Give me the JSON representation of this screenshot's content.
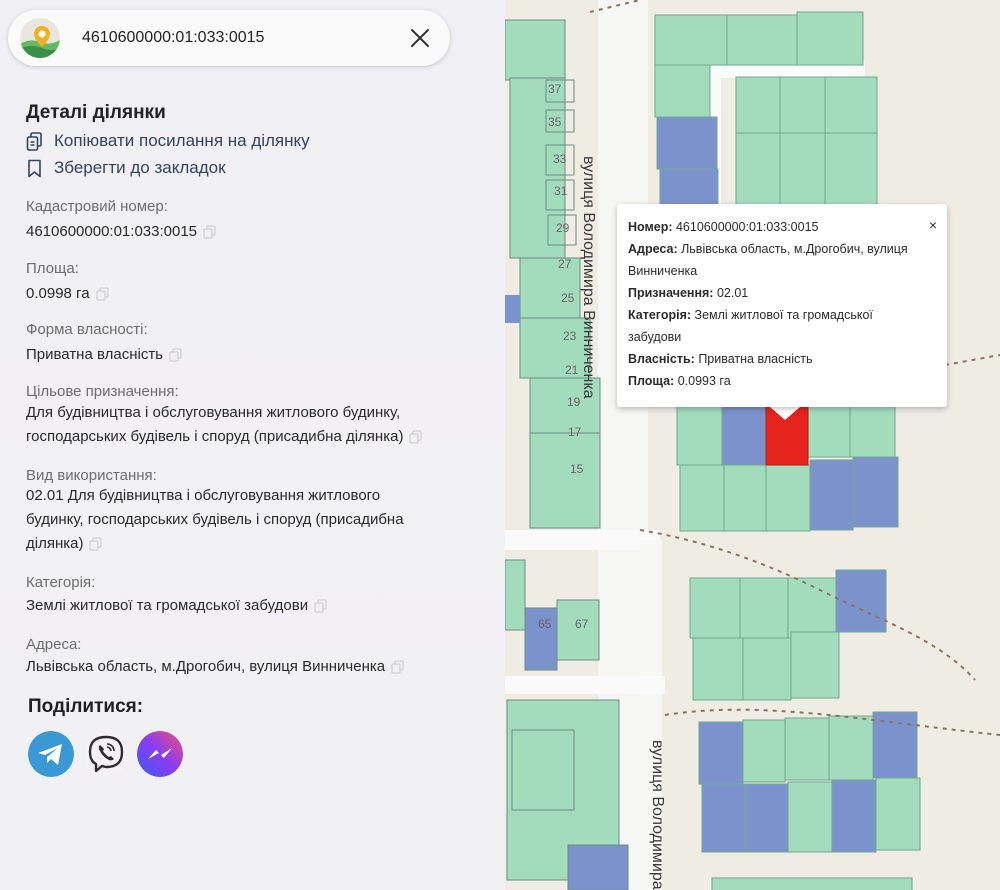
{
  "search": {
    "value": "4610600000:01:033:0015"
  },
  "details": {
    "title": "Деталі ділянки",
    "copy_link_label": "Копіювати посилання на ділянку",
    "bookmark_label": "Зберегти до закладок",
    "fields": [
      {
        "label": "Кадастровий номер:",
        "value": "4610600000:01:033:0015"
      },
      {
        "label": "Площа:",
        "value": "0.0998 га"
      },
      {
        "label": "Форма власності:",
        "value": "Приватна власність"
      },
      {
        "label": "Цільове призначення:",
        "value_line1": "Для будівництва і обслуговування житлового будинку,",
        "value_line2": "господарських будівель і споруд (присадибна ділянка)"
      },
      {
        "label": "Вид використання:",
        "value_line1": "02.01 Для будівництва і обслуговування житлового",
        "value_line2": "будинку, господарських будівель і споруд (присадибна",
        "value_line3": "ділянка)"
      },
      {
        "label": "Категорія:",
        "value": "Землі житлової та громадської забудови"
      },
      {
        "label": "Адреса:",
        "value": "Львівська область, м.Дрогобич, вулиця Винниченка"
      }
    ]
  },
  "share": {
    "title": "Поділитися:",
    "buttons": [
      "telegram-icon",
      "viber-icon",
      "messenger-icon"
    ]
  },
  "popup": {
    "number_label": "Номер:",
    "number_value": "4610600000:01:033:0015",
    "address_label": "Адреса:",
    "address_value_line1": "Львівська область, м.Дрогобич, вулиця",
    "address_value_line2": "Винниченка",
    "purpose_label": "Призначення:",
    "purpose_value": "02.01",
    "category_label": "Категорія:",
    "category_value_line1": "Землі житлової та громадської",
    "category_value_line2": "забудови",
    "ownership_label": "Власність:",
    "ownership_value": "Приватна власність",
    "area_label": "Площа:",
    "area_value": "0.0993 га",
    "close": "×"
  },
  "map": {
    "street_labels": [
      "вулиця Володимира Винниченка",
      "вулиця Володимира"
    ],
    "house_numbers": [
      "37",
      "35",
      "33",
      "31",
      "29",
      "27",
      "25",
      "23",
      "21",
      "19",
      "17",
      "15",
      "65",
      "67"
    ],
    "colors": {
      "parcel_green": "#9fd9b9",
      "parcel_blue": "#7f95cf",
      "parcel_selected": "#e4241d",
      "background": "#efece3"
    }
  }
}
